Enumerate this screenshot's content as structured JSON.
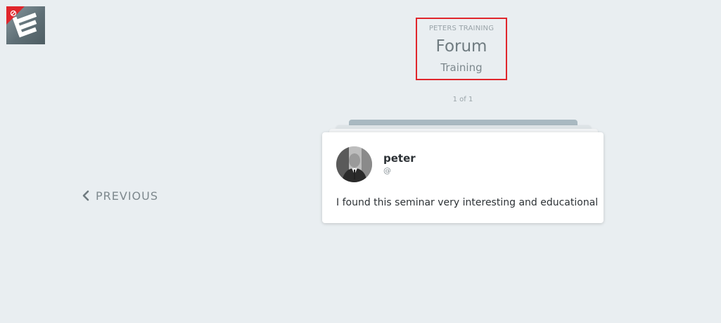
{
  "app": {
    "logo_icon": "app-logo-icon",
    "badge_icon": "notification-badge-icon",
    "badge_color": "#e0262c"
  },
  "header": {
    "kicker": "PETERS TRAINING",
    "title": "Forum",
    "subtitle": "Training",
    "highlight_color": "#e0262c"
  },
  "pager": {
    "text": "1 of 1"
  },
  "nav": {
    "previous_label": "PREVIOUS",
    "previous_icon": "chevron-left-icon"
  },
  "post": {
    "author_name": "peter",
    "author_handle": "@",
    "avatar_icon": "user-avatar",
    "body": "I found this seminar very interesting and educational"
  }
}
